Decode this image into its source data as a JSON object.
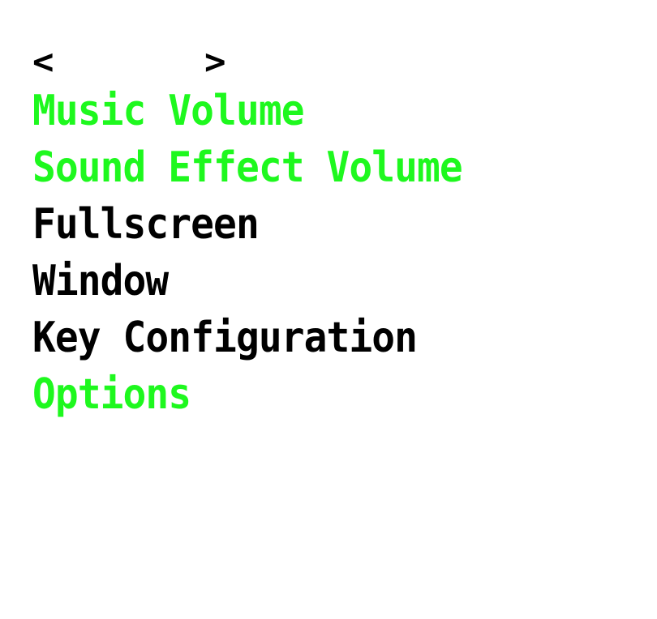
{
  "colors": {
    "highlight": "#1ef81e",
    "normal": "#000000",
    "background": "#ffffff"
  },
  "selector": {
    "left_arrow": "<",
    "right_arrow": ">"
  },
  "menu": {
    "items": [
      {
        "label": "Music Volume",
        "highlighted": true
      },
      {
        "label": "Sound Effect Volume",
        "highlighted": true
      },
      {
        "label": "Fullscreen",
        "highlighted": false
      },
      {
        "label": "Window",
        "highlighted": false
      },
      {
        "label": "Key Configuration",
        "highlighted": false
      },
      {
        "label": "Options",
        "highlighted": true
      }
    ]
  }
}
